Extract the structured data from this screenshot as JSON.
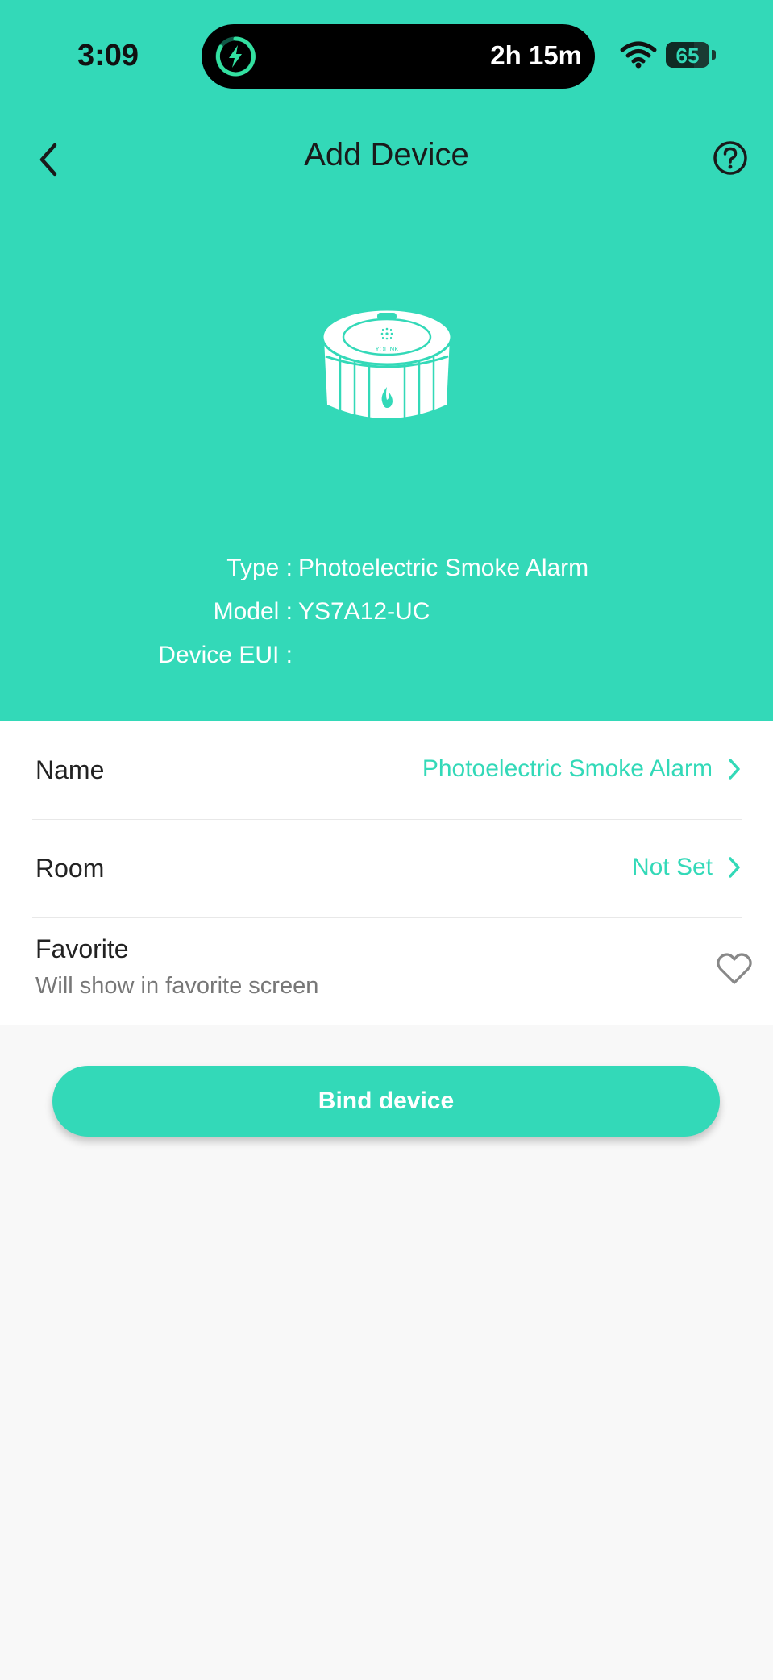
{
  "status_bar": {
    "time": "3:09",
    "island_text": "2h 15m",
    "battery_level": "65",
    "battery_fraction": 0.65
  },
  "header": {
    "title": "Add Device",
    "back_icon": "chevron-left-icon",
    "help_icon": "question-circle-icon"
  },
  "device": {
    "type_label": "Type :",
    "type_value": "Photoelectric Smoke Alarm",
    "model_label": "Model :",
    "model_value": "YS7A12-UC",
    "eui_label": "Device EUI :",
    "eui_value": "",
    "brand": "YOLINK"
  },
  "settings": {
    "name_label": "Name",
    "name_value": "Photoelectric Smoke Alarm",
    "room_label": "Room",
    "room_value": "Not Set",
    "favorite_label": "Favorite",
    "favorite_sub": "Will show in favorite screen"
  },
  "bind_button": "Bind device",
  "colors": {
    "accent": "#33d9b8",
    "page_bg": "#f8f8f8"
  }
}
